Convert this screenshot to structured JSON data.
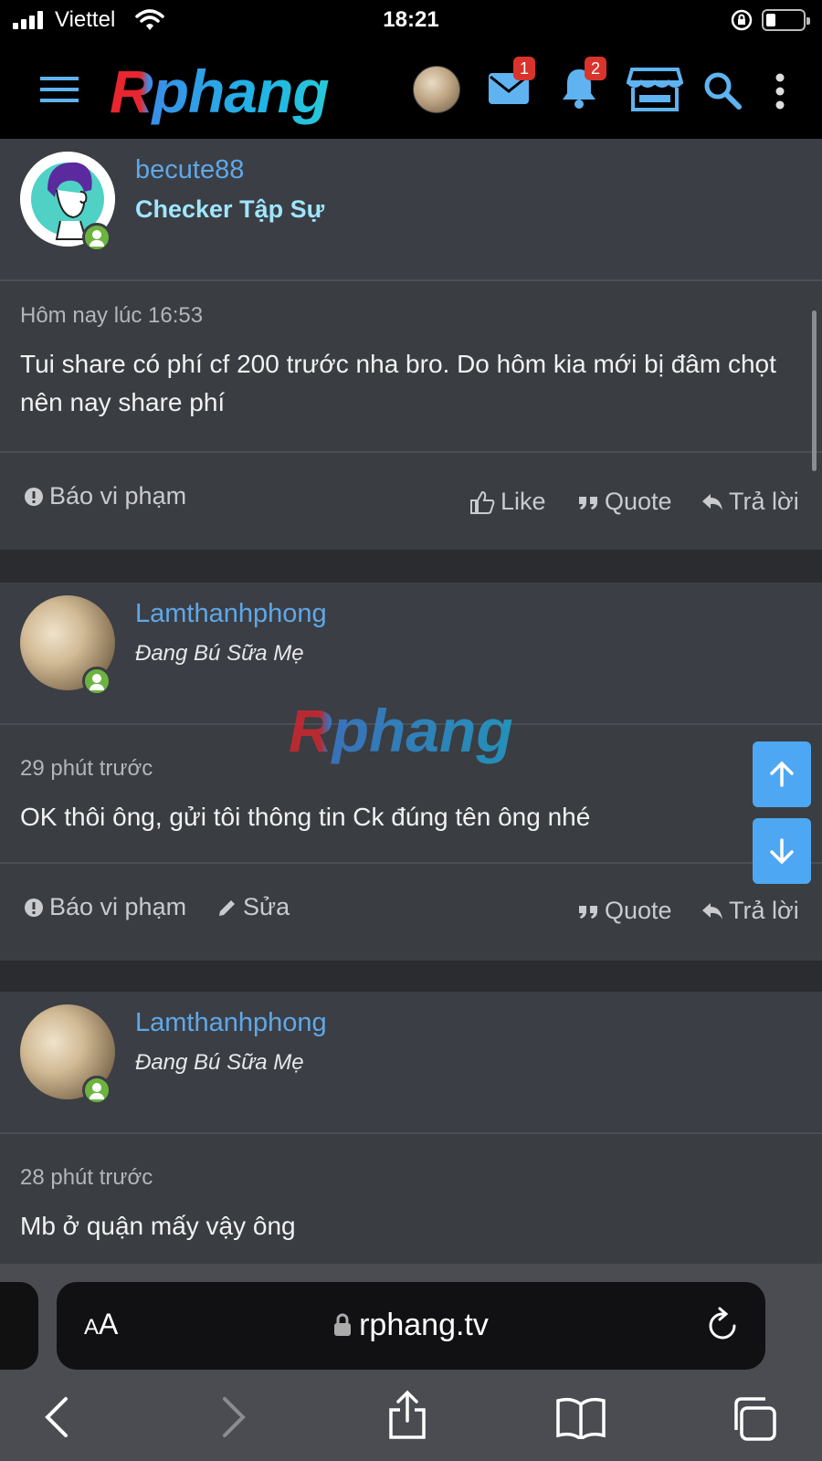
{
  "status_bar": {
    "carrier": "Viettel",
    "time": "18:21"
  },
  "header": {
    "logo_text": "Rphang",
    "inbox_badge": "1",
    "alerts_badge": "2"
  },
  "posts": [
    {
      "username": "becute88",
      "user_title": "Checker Tập Sự",
      "time": "Hôm nay lúc 16:53",
      "body": "Tui share có phí cf 200 trước nha bro. Do hôm kia mới bị đâm chọt nên nay share phí",
      "report": "Báo vi phạm",
      "like": "Like",
      "quote": "Quote",
      "reply": "Trả lời"
    },
    {
      "username": "Lamthanhphong",
      "user_title": "Đang Bú Sữa Mẹ",
      "time": "29 phút trước",
      "body": "OK thôi ông, gửi tôi thông tin Ck đúng tên ông nhé",
      "report": "Báo vi phạm",
      "edit": "Sửa",
      "quote": "Quote",
      "reply": "Trả lời"
    },
    {
      "username": "Lamthanhphong",
      "user_title": "Đang Bú Sữa Mẹ",
      "time": "28 phút trước",
      "body": "Mb ở quận mấy vậy ông"
    }
  ],
  "watermark": "Rphang",
  "browser": {
    "aa_small": "A",
    "aa_large": "A",
    "url": "rphang.tv"
  },
  "colors": {
    "link_blue": "#5fa8e8",
    "fab_blue": "#4ea7f2",
    "online_green": "#6cb33f",
    "badge_red": "#d9342b"
  },
  "icons": [
    "hamburger-icon",
    "mail-icon",
    "bell-icon",
    "store-icon",
    "search-icon",
    "more-vertical-icon",
    "arrow-up-icon",
    "arrow-down-icon",
    "lock-icon",
    "reload-icon",
    "back-icon",
    "forward-icon",
    "share-icon",
    "bookmarks-icon",
    "tabs-icon"
  ]
}
